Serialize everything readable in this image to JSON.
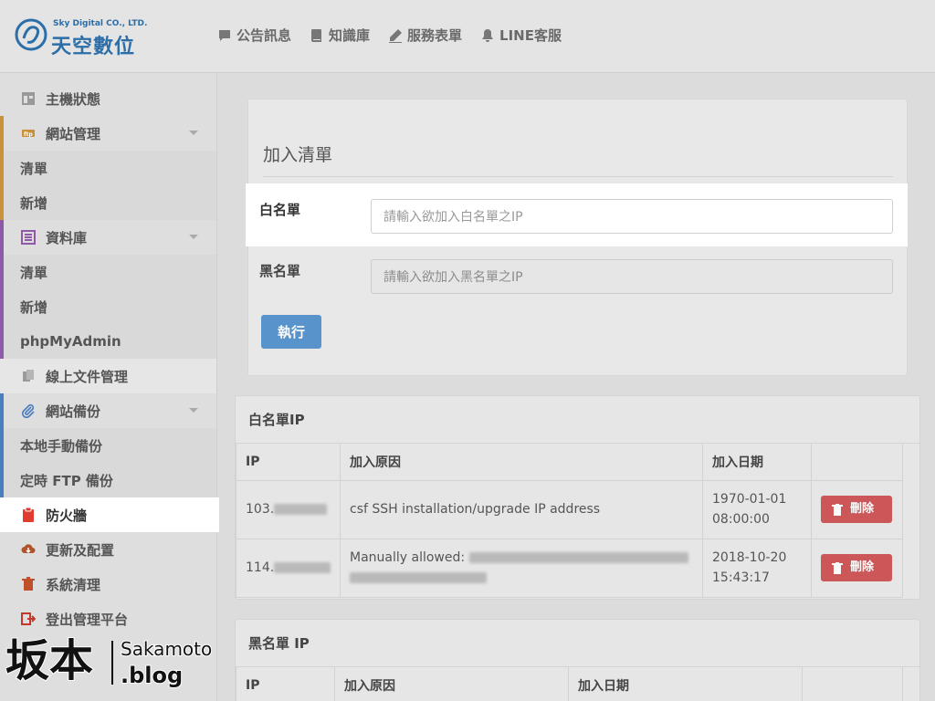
{
  "brand": {
    "small": "Sky Digital CO., LTD.",
    "name": "天空數位",
    "color": "#2c6ea8"
  },
  "topnav": [
    {
      "label": "公告訊息",
      "icon": "chat-icon"
    },
    {
      "label": "知識庫",
      "icon": "book-icon"
    },
    {
      "label": "服務表單",
      "icon": "pencil-icon"
    },
    {
      "label": "LINE客服",
      "icon": "bell-icon"
    }
  ],
  "sidebar": {
    "host_status": "主機狀態",
    "site_mgmt": "網站管理",
    "site_list": "清單",
    "site_add": "新增",
    "database": "資料庫",
    "db_list": "清單",
    "db_add": "新增",
    "phpmyadmin": "phpMyAdmin",
    "file_mgmt": "線上文件管理",
    "backup": "網站備份",
    "local_backup": "本地手動備份",
    "ftp_backup": "定時 FTP 備份",
    "firewall": "防火牆",
    "update": "更新及配置",
    "cleanup": "系統清理",
    "logout": "登出管理平台"
  },
  "add_form": {
    "title": "加入清單",
    "whitelist_label": "白名單",
    "whitelist_placeholder": "請輸入欲加入白名單之IP",
    "blacklist_label": "黑名單",
    "blacklist_placeholder": "請輸入欲加入黑名單之IP",
    "submit_label": "執行"
  },
  "whitelist_table": {
    "title": "白名單IP",
    "columns": [
      "IP",
      "加入原因",
      "加入日期"
    ],
    "rows": [
      {
        "ip": "103.",
        "reason": "csf SSH installation/upgrade IP address",
        "date": "1970-01-01",
        "time": "08:00:00",
        "delete_label": "刪除"
      },
      {
        "ip": "114.",
        "reason": "Manually allowed:",
        "date": "2018-10-20",
        "time": "15:43:17",
        "delete_label": "刪除"
      }
    ]
  },
  "blacklist_table": {
    "title": "黑名單 IP",
    "columns": [
      "IP",
      "加入原因",
      "加入日期"
    ]
  },
  "watermark": {
    "cn": "坂本",
    "en": "Sakamoto",
    "blog": ".blog"
  },
  "colors": {
    "primary_button": "#3f85c6",
    "danger_button": "#c9484a",
    "active_item": "#e03c31"
  }
}
